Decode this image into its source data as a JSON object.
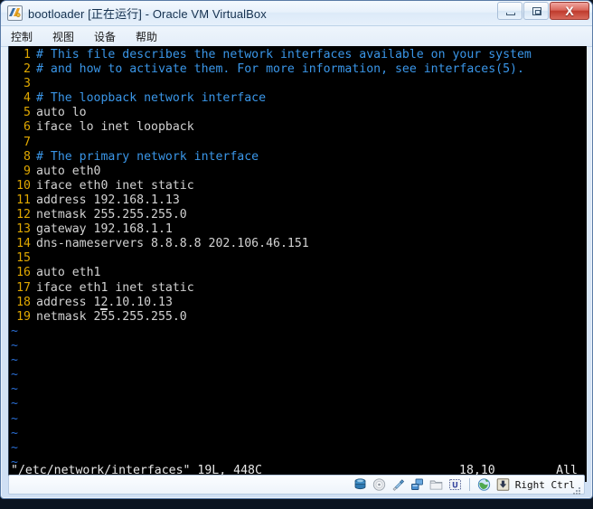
{
  "window": {
    "title": "bootloader [正在运行] - Oracle VM VirtualBox",
    "icon": "virtualbox-icon",
    "buttons": {
      "minimize": "minimize-button",
      "restore": "restore-button",
      "close_label": "X"
    }
  },
  "menubar": {
    "items": [
      {
        "label": "控制",
        "name": "menu-control"
      },
      {
        "label": "视图",
        "name": "menu-view"
      },
      {
        "label": "设备",
        "name": "menu-devices"
      },
      {
        "label": "帮助",
        "name": "menu-help"
      }
    ]
  },
  "terminal": {
    "colors": {
      "background": "#000000",
      "line_number": "#e0a800",
      "comment": "#3a96e8",
      "text": "#d2d2d2",
      "tilde": "#2a6fd6"
    },
    "lines": [
      {
        "n": "1",
        "text": "# This file describes the network interfaces available on your system",
        "kind": "comment"
      },
      {
        "n": "2",
        "text": "# and how to activate them. For more information, see interfaces(5).",
        "kind": "comment"
      },
      {
        "n": "3",
        "text": "",
        "kind": "text"
      },
      {
        "n": "4",
        "text": "# The loopback network interface",
        "kind": "comment"
      },
      {
        "n": "5",
        "text": "auto lo",
        "kind": "text"
      },
      {
        "n": "6",
        "text": "iface lo inet loopback",
        "kind": "text"
      },
      {
        "n": "7",
        "text": "",
        "kind": "text"
      },
      {
        "n": "8",
        "text": "# The primary network interface",
        "kind": "comment"
      },
      {
        "n": "9",
        "text": "auto eth0",
        "kind": "text"
      },
      {
        "n": "10",
        "text": "iface eth0 inet static",
        "kind": "text"
      },
      {
        "n": "11",
        "text": "address 192.168.1.13",
        "kind": "text"
      },
      {
        "n": "12",
        "text": "netmask 255.255.255.0",
        "kind": "text"
      },
      {
        "n": "13",
        "text": "gateway 192.168.1.1",
        "kind": "text"
      },
      {
        "n": "14",
        "text": "dns-nameservers 8.8.8.8 202.106.46.151",
        "kind": "text"
      },
      {
        "n": "15",
        "text": "",
        "kind": "text"
      },
      {
        "n": "16",
        "text": "auto eth1",
        "kind": "text"
      },
      {
        "n": "17",
        "text": "iface eth1 inet static",
        "kind": "text"
      },
      {
        "n": "18",
        "text": "address 12.10.10.13",
        "kind": "text",
        "cursor_col": 9
      },
      {
        "n": "19",
        "text": "netmask 255.255.255.0",
        "kind": "text"
      }
    ],
    "tilde_rows": [
      "~",
      "~",
      "~",
      "~",
      "~",
      "~",
      "~",
      "~",
      "~",
      "~",
      "~",
      "~"
    ],
    "status": {
      "file": "\"/etc/network/interfaces\" 19L, 448C",
      "position": "18,10",
      "percent": "All"
    }
  },
  "vbox_status": {
    "icons": [
      {
        "name": "hard-disk-icon",
        "title": "hard-disk"
      },
      {
        "name": "optical-disk-icon",
        "title": "cd-dvd"
      },
      {
        "name": "usb-icon",
        "title": "usb"
      },
      {
        "name": "network-icon",
        "title": "network"
      },
      {
        "name": "shared-folders-icon",
        "title": "shared-folders"
      },
      {
        "name": "display-icon",
        "title": "display"
      }
    ],
    "icons2": [
      {
        "name": "remote-desktop-icon",
        "title": "remote"
      },
      {
        "name": "mouse-capture-icon",
        "title": "mouse-capture"
      }
    ],
    "host_key": "Right Ctrl"
  }
}
